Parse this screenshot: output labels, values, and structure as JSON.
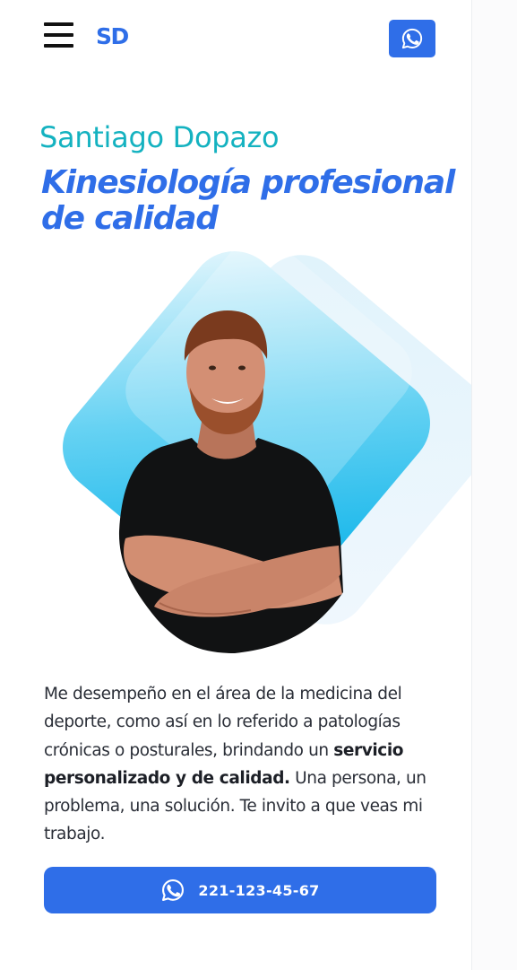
{
  "header": {
    "logo": "SD",
    "menu_icon": "hamburger-menu-icon",
    "whatsapp_icon": "whatsapp-icon"
  },
  "hero": {
    "name": "Santiago Dopazo",
    "tagline": "Kinesiología profesional de calidad",
    "photo": "portrait of man in black t-shirt with crossed arms"
  },
  "description": {
    "part1": "Me desempeño en el área de la medicina del deporte, como así en lo referido a patologías crónicas o posturales, brindando un ",
    "bold": "servicio personalizado y de calidad.",
    "part2": " Una persona, un problema, una solución. Te invito a que veas mi trabajo."
  },
  "cta": {
    "phone": "221-123-45-67",
    "icon": "whatsapp-icon"
  },
  "colors": {
    "primary": "#2f6ee8",
    "teal": "#14b2c0",
    "text": "#2a2e37"
  }
}
